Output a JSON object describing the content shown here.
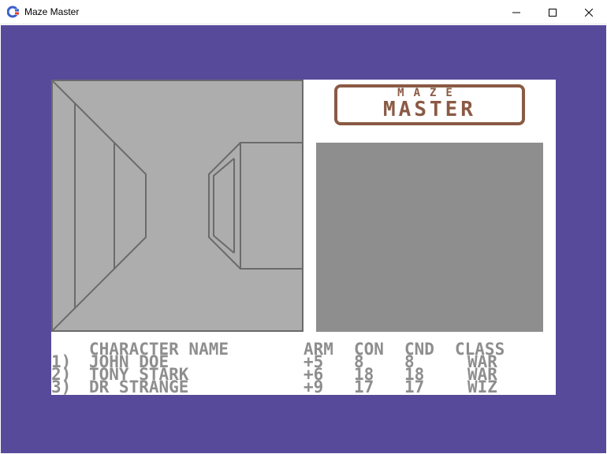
{
  "window": {
    "title": "Maze Master",
    "icon": "c64-emulator-icon",
    "controls": [
      "minimize-icon",
      "maximize-icon",
      "close-icon"
    ]
  },
  "colors": {
    "border": "#584a9a",
    "screen": "#ffffff",
    "maze_wall": "#adadad",
    "maze_line": "#6b6b6b",
    "map_panel": "#8e8e8e",
    "logo": "#8a5a44",
    "text": "#8e8e8e"
  },
  "logo": {
    "line1": "MAZE",
    "line2": "MASTER"
  },
  "roster": {
    "headers": {
      "name": "CHARACTER NAME",
      "arm": "ARM",
      "con": "CON",
      "cnd": "CND",
      "class": "CLASS"
    },
    "characters": [
      {
        "slot": "1)",
        "name": "JOHN DOE",
        "arm": "+5",
        "con": "8",
        "cnd": "8",
        "class": "WAR"
      },
      {
        "slot": "2)",
        "name": "TONY STARK",
        "arm": "+6",
        "con": "18",
        "cnd": "18",
        "class": "WAR"
      },
      {
        "slot": "3)",
        "name": "DR STRANGE",
        "arm": "+9",
        "con": "17",
        "cnd": "17",
        "class": "WIZ"
      }
    ]
  }
}
